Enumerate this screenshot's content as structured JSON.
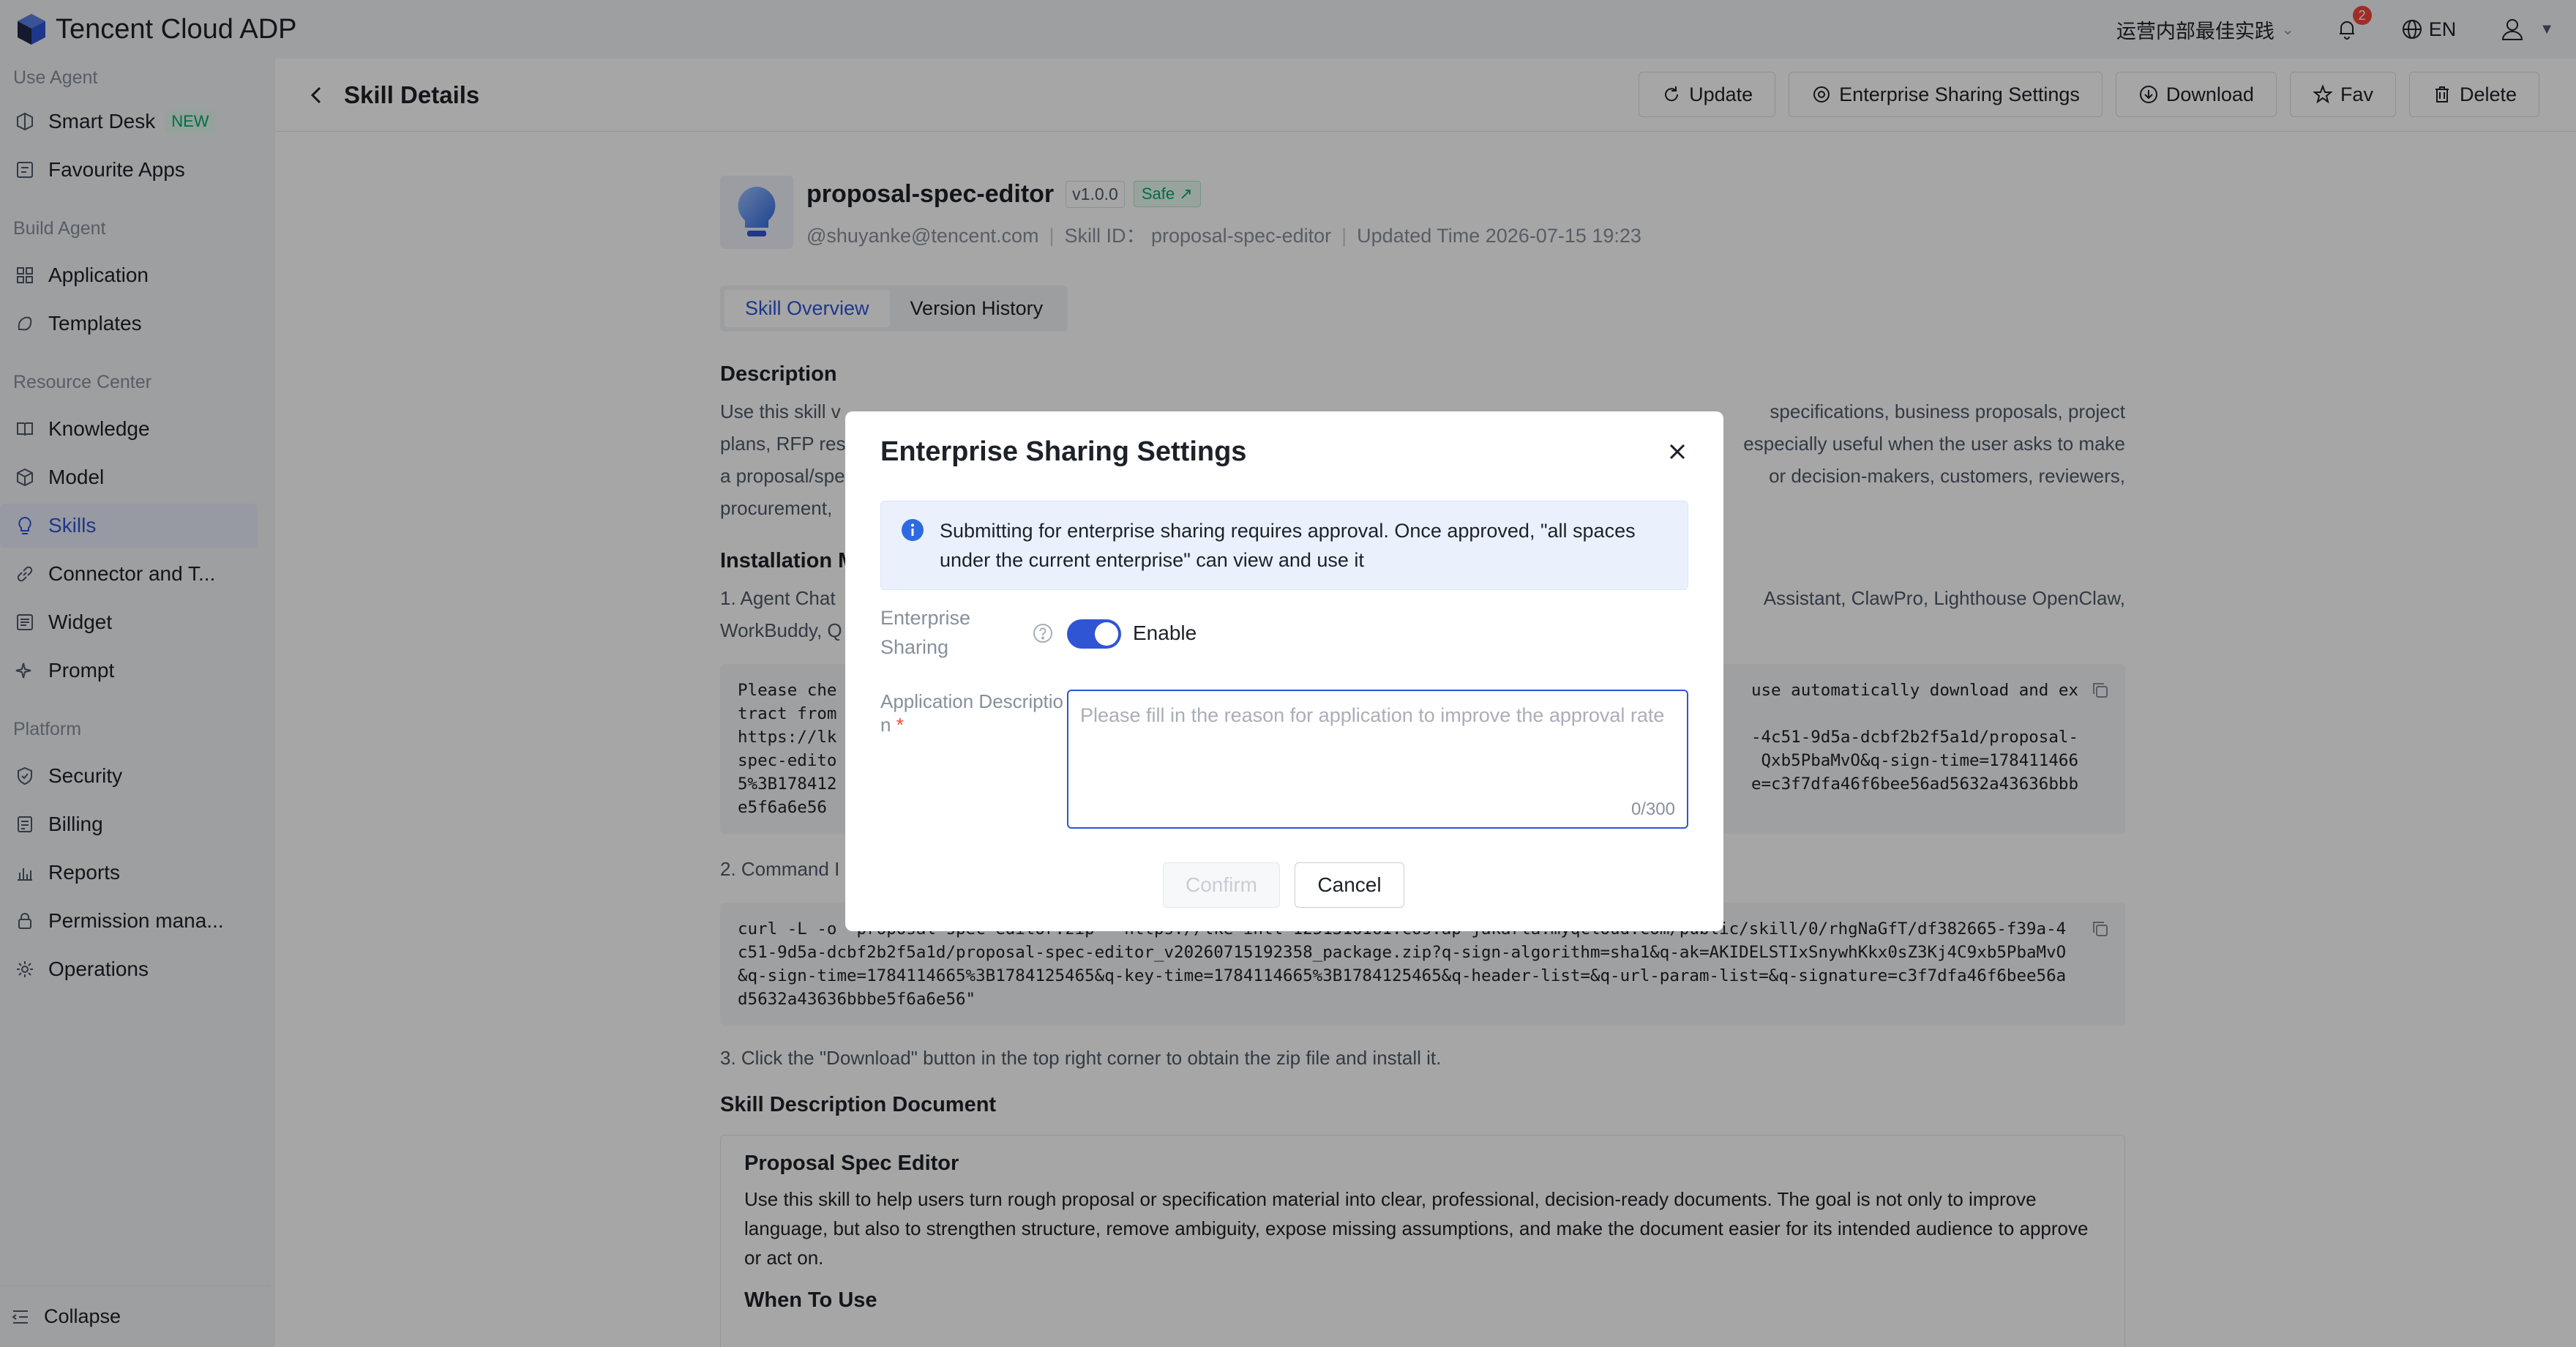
{
  "app": {
    "title": "Tencent Cloud ADP"
  },
  "topbar": {
    "workspace": "运营内部最佳实践",
    "notification_count": "2",
    "language": "EN"
  },
  "sidebar": {
    "sections": {
      "use_agent": "Use Agent",
      "build_agent": "Build Agent",
      "resource_center": "Resource Center",
      "platform": "Platform"
    },
    "items": {
      "smart_desk": "Smart Desk",
      "smart_desk_tag": "NEW",
      "favourite_apps": "Favourite Apps",
      "application": "Application",
      "templates": "Templates",
      "knowledge": "Knowledge",
      "model": "Model",
      "skills": "Skills",
      "connector": "Connector and T...",
      "widget": "Widget",
      "prompt": "Prompt",
      "security": "Security",
      "billing": "Billing",
      "reports": "Reports",
      "permission": "Permission mana...",
      "operations": "Operations"
    },
    "collapse": "Collapse"
  },
  "header": {
    "title": "Skill Details",
    "actions": {
      "update": "Update",
      "sharing": "Enterprise Sharing Settings",
      "download": "Download",
      "fav": "Fav",
      "delete": "Delete"
    }
  },
  "skill": {
    "name": "proposal-spec-editor",
    "version": "v1.0.0",
    "safe": "Safe ↗",
    "author": "@shuyanke@tencent.com",
    "skill_id": "Skill ID： proposal-spec-editor",
    "updated": "Updated Time 2026-07-15 19:23"
  },
  "tabs": {
    "overview": "Skill Overview",
    "history": "Version History"
  },
  "content": {
    "description_title": "Description",
    "description_left": "Use this skill v",
    "description_right": "specifications, business proposals, project",
    "desc_line2_left": "plans, RFP res",
    "desc_line2_right": "especially useful when the user asks to make",
    "desc_line3_left": "a proposal/spe",
    "desc_line3_right": "or decision-makers, customers, reviewers,",
    "desc_line4_left": "procurement,",
    "install_title": "Installation M",
    "step1_left": "1. Agent Chat",
    "step1_right": "Assistant, ClawPro, Lighthouse OpenClaw,",
    "step1_line2": "WorkBuddy, Q",
    "code1_l1_left": "Please che",
    "code1_l1_right": "use automatically download and ex",
    "code1_l2": "tract from",
    "code1_l3_left": "https://lk",
    "code1_l3_right": "-4c51-9d5a-dcbf2b2f5a1d/proposal-",
    "code1_l4_left": "spec-edito",
    "code1_l4_right": "Qxb5PbaMvO&q-sign-time=178411466",
    "code1_l5_left": "5%3B178412",
    "code1_l5_right": "e=c3f7dfa46f6bee56ad5632a43636bbb",
    "code1_l6": "e5f6a6e56",
    "step2": "2. Command I",
    "code2": "curl -L -o \"proposal-spec-editor.zip\" \"https://lke-intl-1251316161.cos.ap-jakarta.myqcloud.com/public/skill/0/rhgNaGfT/df382665-f39a-4c51-9d5a-dcbf2b2f5a1d/proposal-spec-editor_v20260715192358_package.zip?q-sign-algorithm=sha1&q-ak=AKIDELSTIxSnywhKkx0sZ3Kj4C9xb5PbaMvO&q-sign-time=1784114665%3B1784125465&q-key-time=1784114665%3B1784125465&q-header-list=&q-url-param-list=&q-signature=c3f7dfa46f6bee56ad5632a43636bbbe5f6a6e56\"",
    "step3": "3. Click the \"Download\" button in the top right corner to obtain the zip file and install it.",
    "doc_section_title": "Skill Description Document",
    "doc_title": "Proposal Spec Editor",
    "doc_body": "Use this skill to help users turn rough proposal or specification material into clear, professional, decision-ready documents. The goal is not only to improve language, but also to strengthen structure, remove ambiguity, expose missing assumptions, and make the document easier for its intended audience to approve or act on.",
    "doc_when": "When To Use"
  },
  "modal": {
    "title": "Enterprise Sharing Settings",
    "info": "Submitting for enterprise sharing requires approval. Once approved, \"all spaces under the current enterprise\" can view and use it",
    "sharing_label": "Enterprise Sharing",
    "toggle_state": "Enable",
    "desc_label": "Application Description",
    "required_mark": "*",
    "placeholder": "Please fill in the reason for application to improve the approval rate",
    "counter": "0/300",
    "confirm": "Confirm",
    "cancel": "Cancel"
  },
  "colors": {
    "accent": "#2f55d4",
    "safe": "#00a870",
    "badge": "#f5463d"
  }
}
